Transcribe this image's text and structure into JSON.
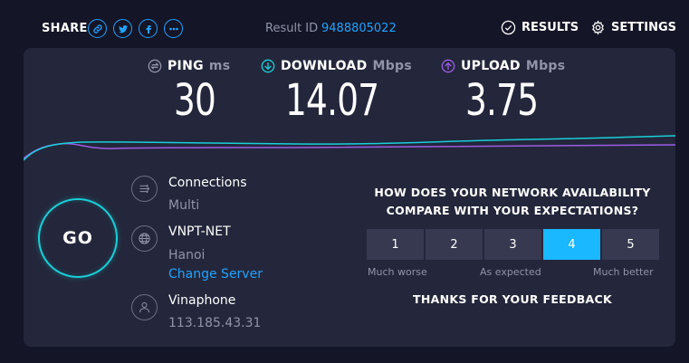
{
  "header": {
    "share_label": "SHARE",
    "share_icons": [
      "link-icon",
      "twitter-icon",
      "facebook-icon",
      "more-icon"
    ],
    "result_label": "Result ID",
    "result_id": "9488805022",
    "results_label": "RESULTS",
    "settings_label": "SETTINGS"
  },
  "metrics": {
    "ping": {
      "label": "PING",
      "unit": "ms",
      "value": "30"
    },
    "download": {
      "label": "DOWNLOAD",
      "unit": "Mbps",
      "value": "14.07"
    },
    "upload": {
      "label": "UPLOAD",
      "unit": "Mbps",
      "value": "3.75"
    }
  },
  "go_label": "GO",
  "server": {
    "connections_title": "Connections",
    "connections_value": "Multi",
    "isp": "VNPT-NET",
    "location": "Hanoi",
    "change_server": "Change Server",
    "provider": "Vinaphone",
    "ip": "113.185.43.31"
  },
  "survey": {
    "question": "HOW DOES YOUR NETWORK AVAILABILITY COMPARE WITH YOUR EXPECTATIONS?",
    "options": [
      "1",
      "2",
      "3",
      "4",
      "5"
    ],
    "selected": "4",
    "label_low": "Much worse",
    "label_mid": "As expected",
    "label_high": "Much better",
    "thanks": "THANKS FOR YOUR FEEDBACK"
  },
  "colors": {
    "background": "#141526",
    "panel": "#24273b",
    "accent_blue": "#1fa3ff",
    "download_line": "#18d0d9",
    "upload_line": "#9b5de5",
    "selected_rating": "#1ab8ff"
  }
}
